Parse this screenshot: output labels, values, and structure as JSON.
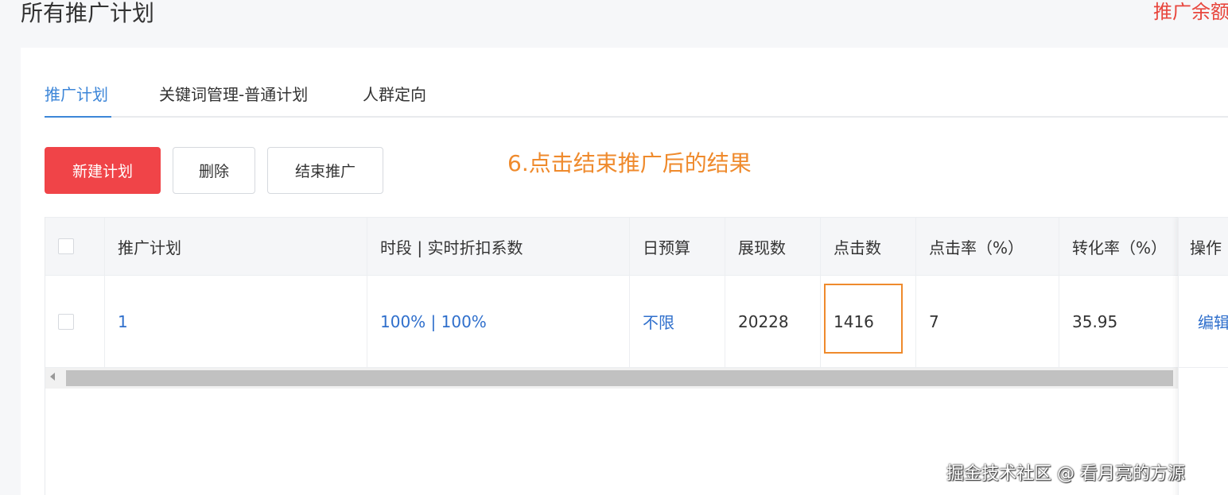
{
  "page": {
    "title": "所有推广计划",
    "balance_label": "推广余额"
  },
  "tabs": [
    {
      "label": "推广计划",
      "active": true
    },
    {
      "label": "关键词管理-普通计划",
      "active": false
    },
    {
      "label": "人群定向",
      "active": false
    }
  ],
  "toolbar": {
    "new_plan_label": "新建计划",
    "delete_label": "删除",
    "end_promo_label": "结束推广"
  },
  "annotation": "6.点击结束推广后的结果",
  "table": {
    "columns": [
      "推广计划",
      "时段 | 实时折扣系数",
      "日预算",
      "展现数",
      "点击数",
      "点击率（%）",
      "转化率（%）",
      "操作"
    ],
    "rows": [
      {
        "plan": "1",
        "period_discount": "100% | 100%",
        "daily_budget": "不限",
        "impressions": "20228",
        "clicks": "1416",
        "ctr": "7",
        "conversion": "35.95",
        "action": "编辑"
      }
    ]
  },
  "watermark": "掘金技术社区 @ 看月亮的方源",
  "colors": {
    "accent_blue": "#3d86d8",
    "primary_red": "#f04448",
    "annotation_orange": "#ef8a2c"
  }
}
